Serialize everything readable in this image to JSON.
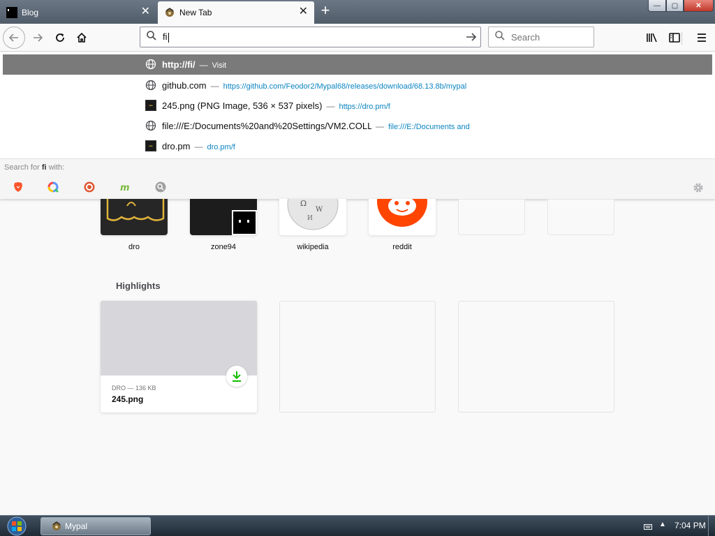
{
  "tabs": [
    {
      "title": "Blog",
      "active": false
    },
    {
      "title": "New Tab",
      "active": true
    }
  ],
  "window_controls": {
    "minimize": "—",
    "maximize": "▢",
    "close": "✕"
  },
  "urlbar": {
    "value": "fi"
  },
  "searchbar": {
    "placeholder": "Search"
  },
  "autocomplete": {
    "rows": [
      {
        "title": "http://fi/",
        "sep": "—",
        "action": "Visit",
        "icon": "globe-icon",
        "selected": true
      },
      {
        "title": "github.com",
        "sep": "—",
        "url": "https://github.com/Feodor2/Mypal68/releases/download/68.13.8b/mypal",
        "icon": "globe-icon",
        "selected": false
      },
      {
        "title": "245.png (PNG Image, 536 × 537 pixels)",
        "sep": "—",
        "url": "https://dro.pm/f",
        "icon": "image-thumb-icon",
        "selected": false
      },
      {
        "title": "file:///E:/Documents%20and%20Settings/VM2.COLL",
        "sep": "—",
        "url": "file:///E:/Documents and",
        "icon": "globe-icon",
        "selected": false
      },
      {
        "title": "dro.pm",
        "sep": "—",
        "url": "dro.pm/f",
        "icon": "image-thumb-icon",
        "selected": false
      }
    ],
    "search_header_prefix": "Search for ",
    "search_header_term": "fi",
    "search_header_suffix": " with:",
    "engines": [
      "brave-icon",
      "qwant-icon",
      "duckduckgo-icon",
      "mojeek-icon",
      "search-engine-icon"
    ]
  },
  "top_sites": [
    {
      "label": "dro"
    },
    {
      "label": "zone94"
    },
    {
      "label": "wikipedia"
    },
    {
      "label": "reddit"
    },
    {
      "label": ""
    },
    {
      "label": ""
    }
  ],
  "highlights": {
    "title": "Highlights",
    "cards": [
      {
        "meta": "DRO — 136 KB",
        "name": "245.png"
      }
    ]
  },
  "taskbar": {
    "app_label": "Mypal",
    "clock": "7:04 PM"
  },
  "colors": {
    "selected_row": "#7a7a7a",
    "link_blue": "#0a84c1",
    "reddit_orange": "#ff4500",
    "download_green": "#12bc00"
  }
}
